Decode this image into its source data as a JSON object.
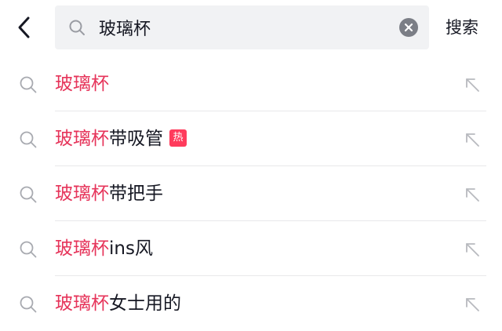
{
  "header": {
    "query": "玻璃杯",
    "submit_label": "搜索",
    "icons": {
      "back": "chevron-left-icon",
      "search": "search-icon",
      "clear": "clear-icon"
    }
  },
  "suggestions": [
    {
      "highlight": "玻璃杯",
      "rest": ""
    },
    {
      "highlight": "玻璃杯",
      "rest": "带吸管",
      "badge": "热"
    },
    {
      "highlight": "玻璃杯",
      "rest": "带把手"
    },
    {
      "highlight": "玻璃杯",
      "rest": "ins风"
    },
    {
      "highlight": "玻璃杯",
      "rest": "女士用的"
    }
  ],
  "colors": {
    "highlight": "#e6345a",
    "hot_badge": "#ff3b5c",
    "search_bg": "#f1f2f4",
    "text": "#161823"
  }
}
